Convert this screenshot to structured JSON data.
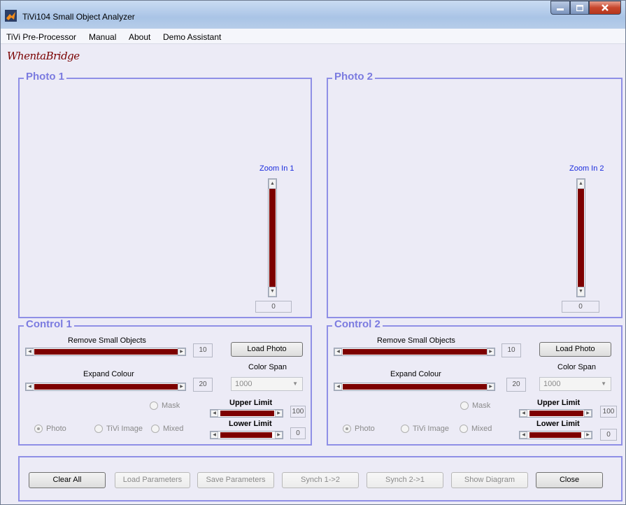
{
  "window": {
    "title": "TiVi104 Small Object Analyzer"
  },
  "menu": [
    "TiVi Pre-Processor",
    "Manual",
    "About",
    "Demo Assistant"
  ],
  "logo_text": "WhentaBridge",
  "photo1": {
    "title": "Photo 1",
    "zoom_label": "Zoom In 1",
    "zoom_value": "0"
  },
  "photo2": {
    "title": "Photo 2",
    "zoom_label": "Zoom In 2",
    "zoom_value": "0"
  },
  "control1": {
    "title": "Control 1",
    "remove_label": "Remove Small Objects",
    "remove_value": "10",
    "expand_label": "Expand Colour",
    "expand_value": "20",
    "load_photo": "Load Photo",
    "color_span_label": "Color Span",
    "color_span_value": "1000",
    "mask": "Mask",
    "upper_label": "Upper Limit",
    "upper_value": "100",
    "lower_label": "Lower Limit",
    "lower_value": "0",
    "radio_photo": "Photo",
    "radio_tivi": "TiVi Image",
    "radio_mixed": "Mixed"
  },
  "control2": {
    "title": "Control 2",
    "remove_label": "Remove Small Objects",
    "remove_value": "10",
    "expand_label": "Expand Colour",
    "expand_value": "20",
    "load_photo": "Load Photo",
    "color_span_label": "Color Span",
    "color_span_value": "1000",
    "mask": "Mask",
    "upper_label": "Upper Limit",
    "upper_value": "100",
    "lower_label": "Lower Limit",
    "lower_value": "0",
    "radio_photo": "Photo",
    "radio_tivi": "TiVi Image",
    "radio_mixed": "Mixed"
  },
  "bottom": {
    "clear_all": "Clear All",
    "load_parameters": "Load Parameters",
    "save_parameters": "Save Parameters",
    "synch_12": "Synch 1->2",
    "synch_21": "Synch 2->1",
    "show_diagram": "Show Diagram",
    "close": "Close"
  },
  "colors": {
    "panel_border": "#8f8fe6",
    "panel_title": "#7b7be0",
    "slider_fill": "#7d0000",
    "zoom_label": "#1a2bdd"
  }
}
